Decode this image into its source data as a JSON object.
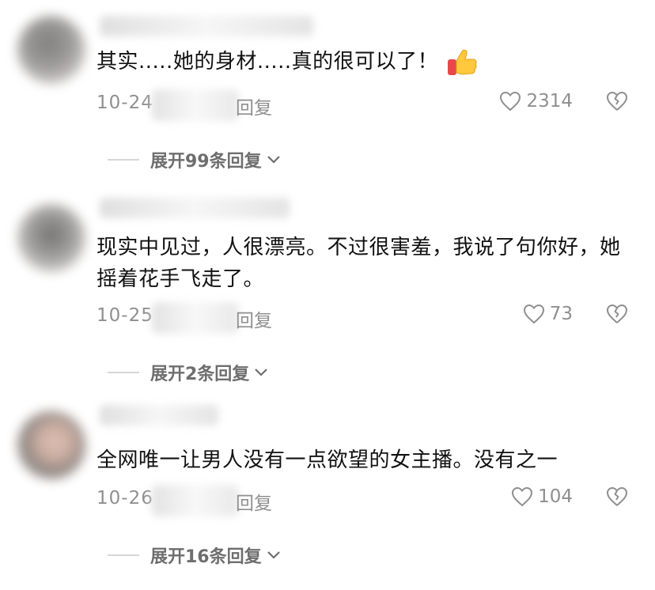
{
  "comments": [
    {
      "text": "其实.....她的身材.....真的很可以了！",
      "emoji": "thumbs-up-emoji",
      "date": "10-24",
      "reply_label": "回复",
      "likes": "2314",
      "expand_label": "展开99条回复"
    },
    {
      "text": "现实中见过，人很漂亮。不过很害羞，我说了句你好，她摇着花手飞走了。",
      "date": "10-25",
      "reply_label": "回复",
      "likes": "73",
      "expand_label": "展开2条回复"
    },
    {
      "text": "全网唯一让男人没有一点欲望的女主播。没有之一",
      "date": "10-26",
      "reply_label": "回复",
      "likes": "104",
      "expand_label": "展开16条回复"
    }
  ],
  "colors": {
    "text": "#111111",
    "meta": "#8f8f8f",
    "expand": "#6e6e6e",
    "divider": "#d7d7d7",
    "emoji_hand": "#ffc83d",
    "emoji_sleeve": "#e8484a"
  },
  "icons": {
    "like": "heart-outline-icon",
    "dislike": "broken-heart-icon",
    "expand": "chevron-down-icon"
  }
}
